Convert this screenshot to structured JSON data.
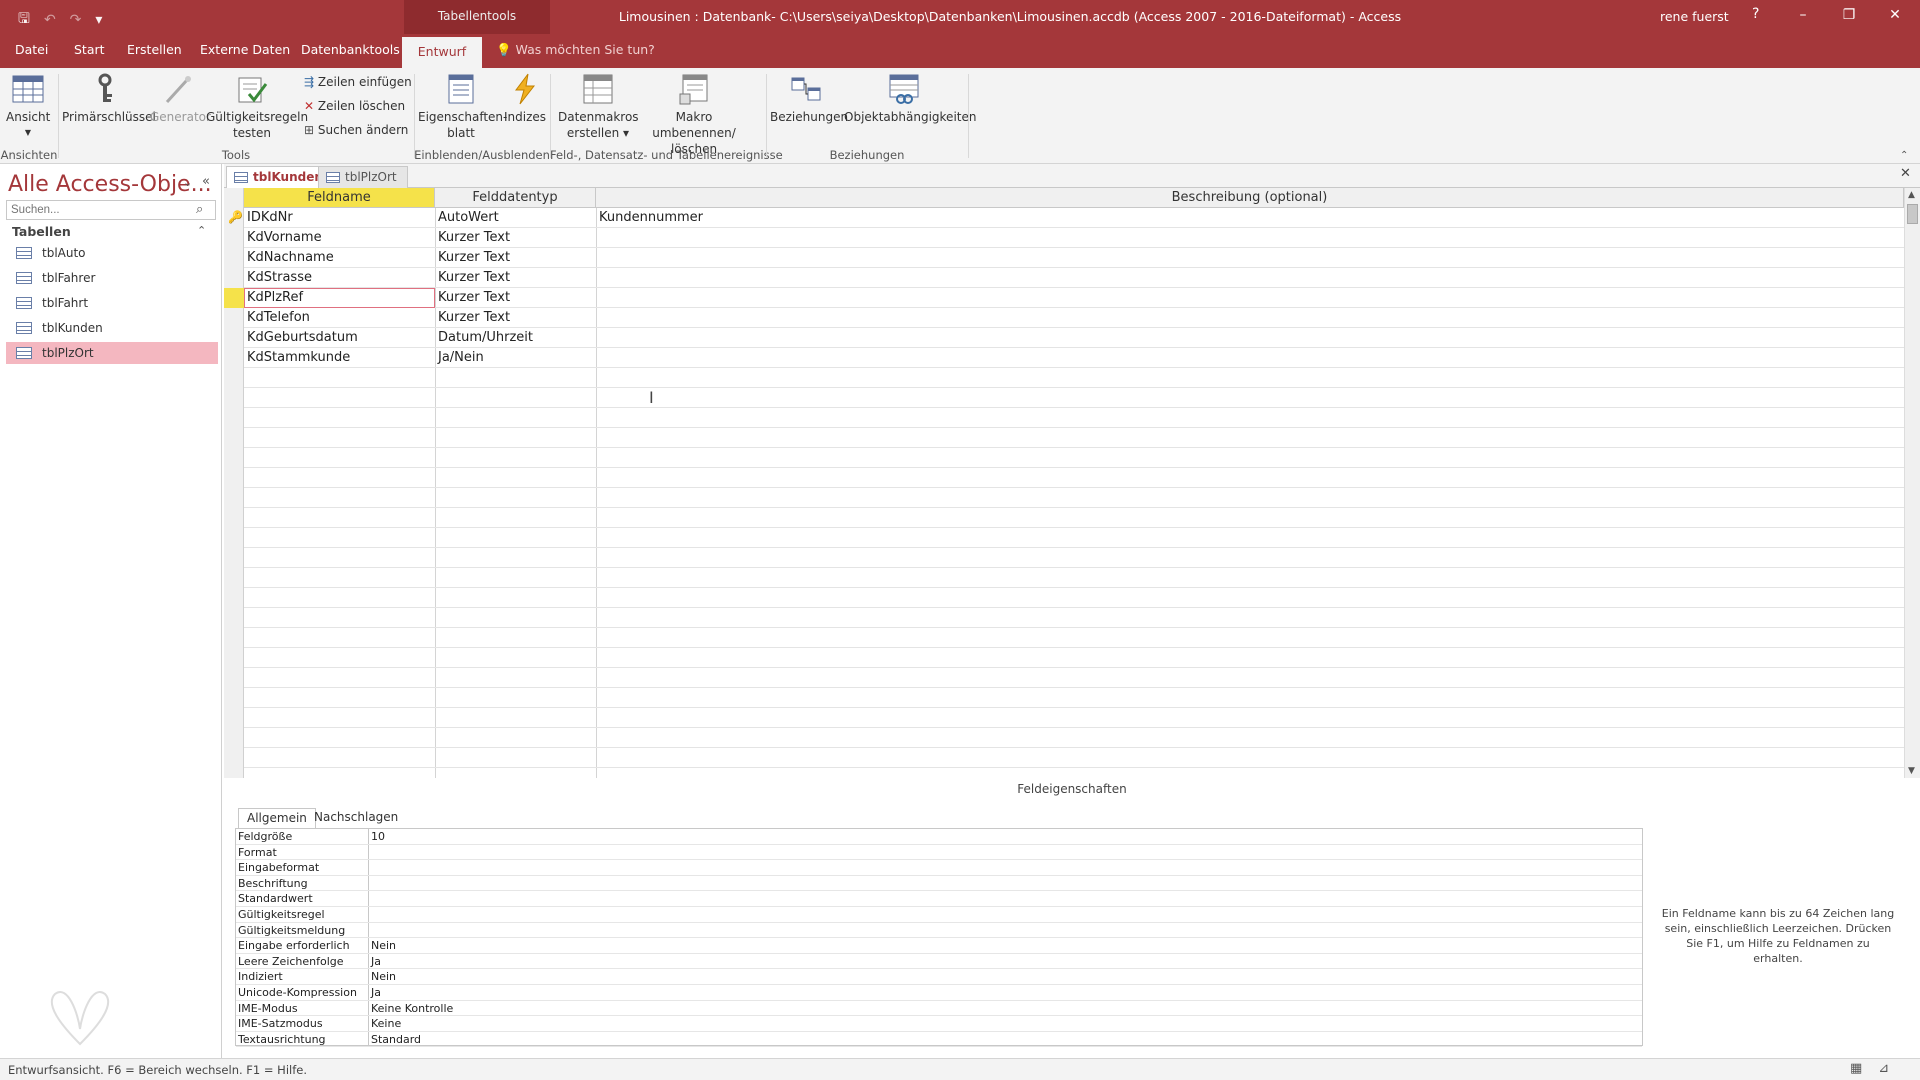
{
  "titlebar": {
    "context_label": "Tabellentools",
    "title": "Limousinen : Datenbank- C:\\Users\\seiya\\Desktop\\Datenbanken\\Limousinen.accdb (Access 2007 - 2016-Dateiformat)  -  Access",
    "user": "rene fuerst",
    "help": "?",
    "minimize": "–",
    "restore": "❐",
    "close": "✕"
  },
  "qat": {
    "save": "🖫",
    "undo": "↶",
    "redo": "↷",
    "customize": "▾"
  },
  "ribbon_tabs": {
    "datei": "Datei",
    "start": "Start",
    "erstellen": "Erstellen",
    "externe": "Externe Daten",
    "datenbanktools": "Datenbanktools",
    "entwurf": "Entwurf",
    "tellme": "Was möchten Sie tun?"
  },
  "ribbon": {
    "ansicht": "Ansicht",
    "primaer": "Primärschlüssel",
    "generator": "Generator",
    "gueltig_1": "Gültigkeitsregeln",
    "gueltig_2": "testen",
    "zeilen_einfuegen": "Zeilen einfügen",
    "zeilen_loeschen": "Zeilen löschen",
    "suchen_aendern": "Suchen ändern",
    "eigenschaften_1": "Eigenschaften-",
    "eigenschaften_2": "blatt",
    "indizes": "Indizes",
    "datenmakros_1": "Datenmakros",
    "datenmakros_2": "erstellen ▾",
    "makro_1": "Makro umbenennen/",
    "makro_2": "löschen",
    "beziehungen": "Beziehungen",
    "objektabh": "Objektabhängigkeiten",
    "groups": {
      "ansichten": "Ansichten",
      "tools": "Tools",
      "einblenden": "Einblenden/Ausblenden",
      "ereignisse": "Feld-, Datensatz- und Tabellenereignisse",
      "beziehungen": "Beziehungen"
    }
  },
  "nav": {
    "title": "Alle Access-Obje...",
    "search_placeholder": "Suchen...",
    "section": "Tabellen",
    "items": [
      "tblAuto",
      "tblFahrer",
      "tblFahrt",
      "tblKunden",
      "tblPlzOrt"
    ]
  },
  "doctabs": [
    "tblKunden",
    "tblPlzOrt"
  ],
  "grid": {
    "headers": {
      "feldname": "Feldname",
      "felddatentyp": "Felddatentyp",
      "beschreibung": "Beschreibung (optional)"
    },
    "rows": [
      {
        "name": "IDKdNr",
        "type": "AutoWert",
        "desc": "Kundennummer"
      },
      {
        "name": "KdVorname",
        "type": "Kurzer Text",
        "desc": ""
      },
      {
        "name": "KdNachname",
        "type": "Kurzer Text",
        "desc": ""
      },
      {
        "name": "KdStrasse",
        "type": "Kurzer Text",
        "desc": ""
      },
      {
        "name": "KdPlzRef",
        "type": "Kurzer Text",
        "desc": ""
      },
      {
        "name": "KdTelefon",
        "type": "Kurzer Text",
        "desc": ""
      },
      {
        "name": "KdGeburtsdatum",
        "type": "Datum/Uhrzeit",
        "desc": ""
      },
      {
        "name": "KdStammkunde",
        "type": "Ja/Nein",
        "desc": ""
      }
    ]
  },
  "field_props": {
    "title": "Feldeigenschaften",
    "tabs": [
      "Allgemein",
      "Nachschlagen"
    ],
    "rows": [
      {
        "label": "Feldgröße",
        "value": "10"
      },
      {
        "label": "Format",
        "value": ""
      },
      {
        "label": "Eingabeformat",
        "value": ""
      },
      {
        "label": "Beschriftung",
        "value": ""
      },
      {
        "label": "Standardwert",
        "value": ""
      },
      {
        "label": "Gültigkeitsregel",
        "value": ""
      },
      {
        "label": "Gültigkeitsmeldung",
        "value": ""
      },
      {
        "label": "Eingabe erforderlich",
        "value": "Nein"
      },
      {
        "label": "Leere Zeichenfolge",
        "value": "Ja"
      },
      {
        "label": "Indiziert",
        "value": "Nein"
      },
      {
        "label": "Unicode-Kompression",
        "value": "Ja"
      },
      {
        "label": "IME-Modus",
        "value": "Keine Kontrolle"
      },
      {
        "label": "IME-Satzmodus",
        "value": "Keine"
      },
      {
        "label": "Textausrichtung",
        "value": "Standard"
      }
    ],
    "help": "Ein Feldname kann bis zu 64 Zeichen lang sein, einschließlich Leerzeichen. Drücken Sie F1, um Hilfe zu Feldnamen zu erhalten."
  },
  "status": {
    "text": "Entwurfsansicht.  F6 = Bereich wechseln.  F1 = Hilfe."
  },
  "colors": {
    "accent": "#a4373a",
    "header_highlight": "#f5e24a",
    "nav_selected": "#f4b7c0"
  }
}
